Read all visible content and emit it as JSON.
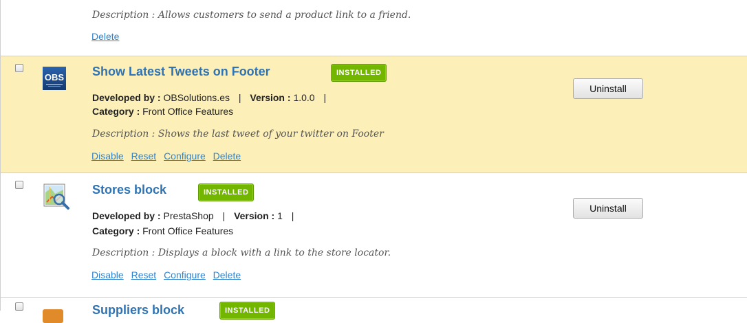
{
  "top_module": {
    "description": "Description : Allows customers to send a product link to a friend.",
    "links": [
      "Delete"
    ]
  },
  "modules": [
    {
      "name": "Show Latest Tweets on Footer",
      "status": "INSTALLED",
      "developed_by_label": "Developed by :",
      "developer": "OBSolutions.es",
      "version_label": "Version :",
      "version": "1.0.0",
      "separator": "|",
      "category_label": "Category :",
      "category": "Front Office Features",
      "description": "Description : Shows the last tweet of your twitter on Footer",
      "links": [
        "Disable",
        "Reset",
        "Configure",
        "Delete"
      ],
      "action": "Uninstall",
      "logo_text": "OBS",
      "highlighted": true
    },
    {
      "name": "Stores block",
      "status": "INSTALLED",
      "developed_by_label": "Developed by :",
      "developer": "PrestaShop",
      "version_label": "Version :",
      "version": "1",
      "separator": "|",
      "category_label": "Category :",
      "category": "Front Office Features",
      "description": "Description : Displays a block with a link to the store locator.",
      "links": [
        "Disable",
        "Reset",
        "Configure",
        "Delete"
      ],
      "action": "Uninstall",
      "icon": "map-magnifier-icon",
      "highlighted": false
    },
    {
      "name": "Suppliers block",
      "status": "INSTALLED"
    }
  ],
  "colors": {
    "highlight_row": "#fcefb8",
    "title": "#2f73b3",
    "link": "#2f84d0",
    "badge": "#72b600"
  }
}
